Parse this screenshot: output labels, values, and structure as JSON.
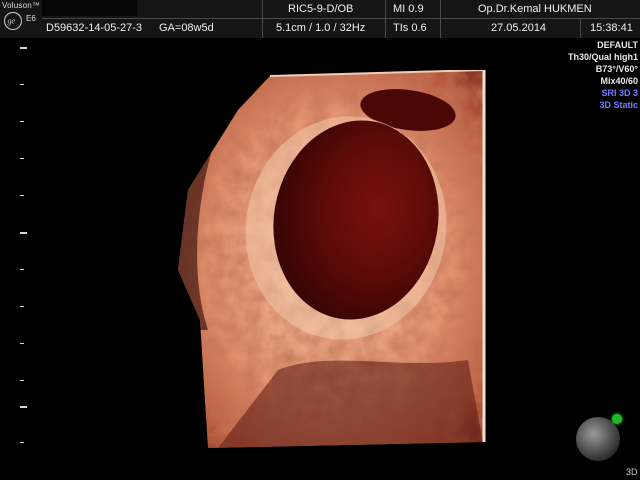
{
  "brand": {
    "name": "Voluson™",
    "model": "E6",
    "logo_icon": "ge-logo-icon"
  },
  "header": {
    "patient_id": "D59632-14-05-27-3",
    "ga": "GA=08w5d",
    "probe": "RIC5-9-D/OB",
    "scan_params": "5.1cm / 1.0 / 32Hz",
    "mi": "MI  0.9",
    "tis": "TIs  0.6",
    "doctor": "Op.Dr.Kemal HUKMEN",
    "date": "27.05.2014",
    "time": "15:38:41"
  },
  "params": [
    {
      "text": "DEFAULT",
      "color": "#e8e8e8"
    },
    {
      "text": "Th30/Qual high1",
      "color": "#e8e8e8"
    },
    {
      "text": "B73°/V60°",
      "color": "#e8e8e8"
    },
    {
      "text": "Mix40/60",
      "color": "#e8e8e8"
    },
    {
      "text": "SRI 3D 3",
      "color": "#6f7fff"
    },
    {
      "text": "3D Static",
      "color": "#6f7fff"
    }
  ],
  "orientation": {
    "label": "3D",
    "ball_icon": "orientation-ball-icon",
    "marker_color": "#1fb82a"
  },
  "colors": {
    "background": "#000000",
    "header": "#151515",
    "tissue": "#e8a078",
    "cavity": "#5a0a08",
    "accent_blue": "#6f7fff"
  }
}
